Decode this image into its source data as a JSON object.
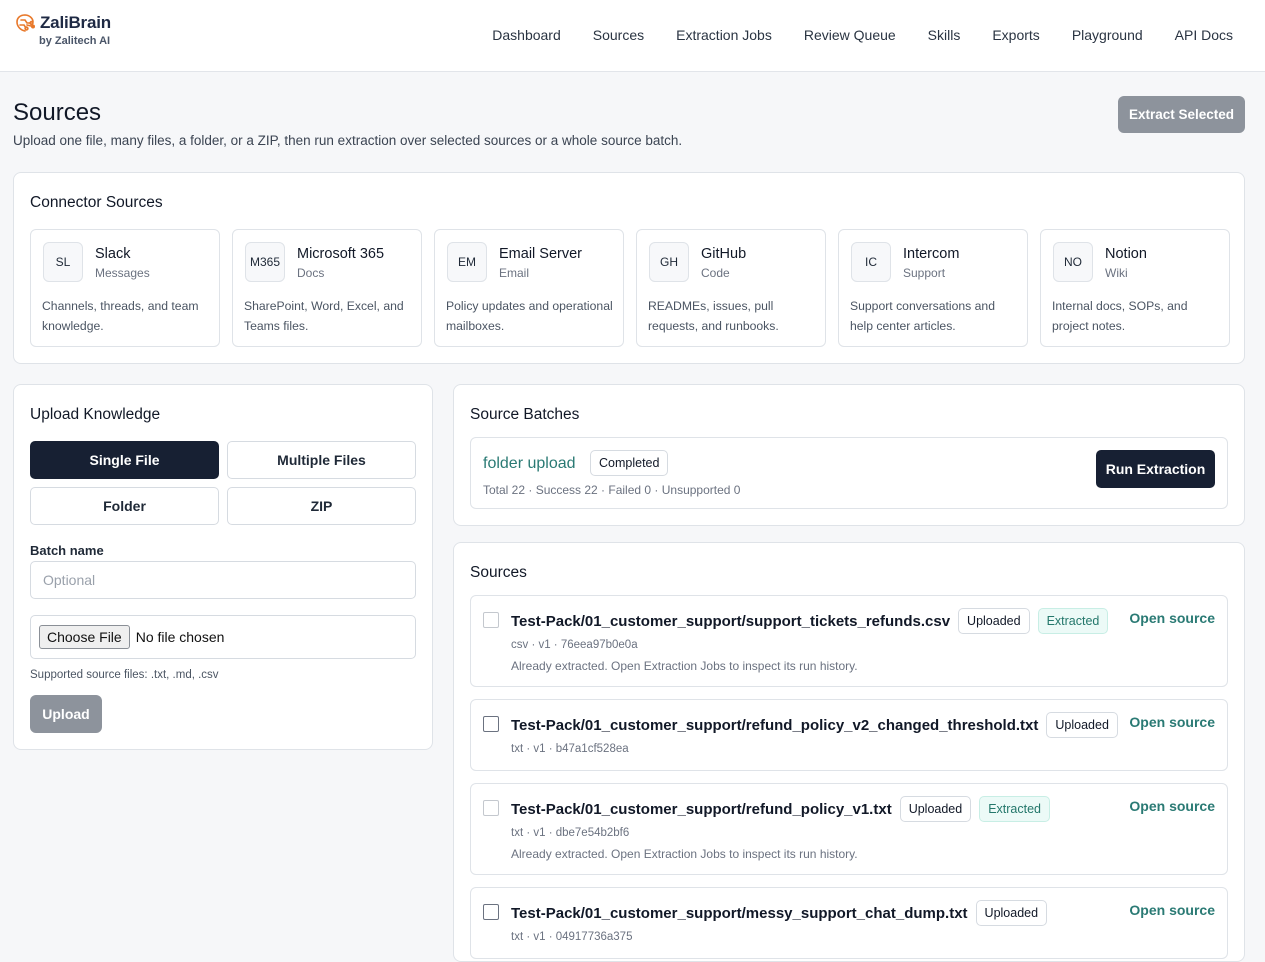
{
  "brand": {
    "name": "ZaliBrain",
    "sub": "by Zalitech AI",
    "accent": "#e8782a"
  },
  "nav": [
    "Dashboard",
    "Sources",
    "Extraction Jobs",
    "Review Queue",
    "Skills",
    "Exports",
    "Playground",
    "API Docs"
  ],
  "page": {
    "title": "Sources",
    "description": "Upload one file, many files, a folder, or a ZIP, then run extraction over selected sources or a whole source batch.",
    "extract_selected": "Extract Selected"
  },
  "connectors": {
    "title": "Connector Sources",
    "items": [
      {
        "abbr": "SL",
        "name": "Slack",
        "type": "Messages",
        "desc": "Channels, threads, and team knowledge."
      },
      {
        "abbr": "M365",
        "name": "Microsoft 365",
        "type": "Docs",
        "desc": "SharePoint, Word, Excel, and Teams files."
      },
      {
        "abbr": "EM",
        "name": "Email Server",
        "type": "Email",
        "desc": "Policy updates and operational mailboxes."
      },
      {
        "abbr": "GH",
        "name": "GitHub",
        "type": "Code",
        "desc": "READMEs, issues, pull requests, and runbooks."
      },
      {
        "abbr": "IC",
        "name": "Intercom",
        "type": "Support",
        "desc": "Support conversations and help center articles."
      },
      {
        "abbr": "NO",
        "name": "Notion",
        "type": "Wiki",
        "desc": "Internal docs, SOPs, and project notes."
      }
    ]
  },
  "upload": {
    "title": "Upload Knowledge",
    "modes": [
      "Single File",
      "Multiple Files",
      "Folder",
      "ZIP"
    ],
    "active_mode": "Single File",
    "batch_label": "Batch name",
    "batch_placeholder": "Optional",
    "choose_file": "Choose File",
    "no_file": "No file chosen",
    "supported": "Supported source files: .txt, .md, .csv",
    "upload_button": "Upload"
  },
  "batches": {
    "title": "Source Batches",
    "items": [
      {
        "name": "folder upload",
        "status": "Completed",
        "stats": "Total 22 · Success 22 · Failed 0 · Unsupported 0",
        "action": "Run Extraction"
      }
    ]
  },
  "sources": {
    "title": "Sources",
    "open_label": "Open source",
    "items": [
      {
        "name": "Test-Pack/01_customer_support/support_tickets_refunds.csv",
        "badges": [
          "Uploaded",
          "Extracted"
        ],
        "meta": "csv · v1 · 76eea97b0e0a",
        "note": "Already extracted. Open Extraction Jobs to inspect its run history."
      },
      {
        "name": "Test-Pack/01_customer_support/refund_policy_v2_changed_threshold.txt",
        "badges": [
          "Uploaded"
        ],
        "meta": "txt · v1 · b47a1cf528ea",
        "note": ""
      },
      {
        "name": "Test-Pack/01_customer_support/refund_policy_v1.txt",
        "badges": [
          "Uploaded",
          "Extracted"
        ],
        "meta": "txt · v1 · dbe7e54b2bf6",
        "note": "Already extracted. Open Extraction Jobs to inspect its run history."
      },
      {
        "name": "Test-Pack/01_customer_support/messy_support_chat_dump.txt",
        "badges": [
          "Uploaded"
        ],
        "meta": "txt · v1 · 04917736a375",
        "note": ""
      }
    ]
  }
}
